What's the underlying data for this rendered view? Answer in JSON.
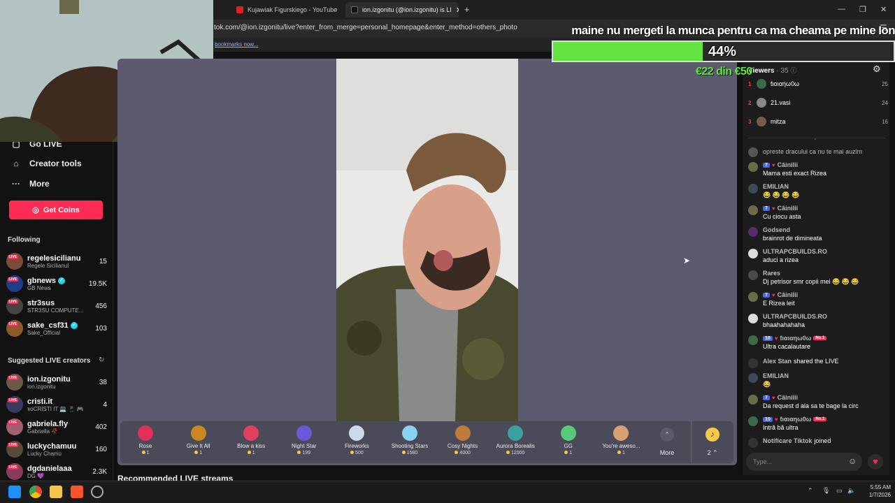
{
  "browser": {
    "tabs": [
      {
        "title": "Kujawiak Figurskiego - YouTube",
        "active": false
      },
      {
        "title": "ion.izgonitu (@ion.izgonitu) is LI",
        "active": true
      }
    ],
    "url": "tok.com/@ion.izgonitu/live?enter_from_merge=personal_homepage&enter_method=others_photo",
    "bookmarks_link": "bookmarks now..."
  },
  "overlay": {
    "goal_text": "maine nu mergeti la munca pentru ca ma cheama pe mine Ion",
    "goal_percent_label": "44%",
    "goal_fraction": 0.44,
    "goal_amount": "€22 din €50"
  },
  "sidebar": {
    "nav": [
      {
        "label": "Go LIVE",
        "icon": "camera-icon"
      },
      {
        "label": "Creator tools",
        "icon": "home-icon"
      },
      {
        "label": "More",
        "icon": "more-icon"
      }
    ],
    "get_coins": "Get Coins",
    "following_title": "Following",
    "following": [
      {
        "name": "regelesicilianu",
        "sub": "Regele Sicilianul",
        "count": "15",
        "color": "#7a4b3a",
        "verified": false
      },
      {
        "name": "gbnews",
        "sub": "GB News",
        "count": "19.5K",
        "color": "#1f3c88",
        "verified": true
      },
      {
        "name": "str3sus",
        "sub": "STR3SU COMPUTE...",
        "count": "456",
        "color": "#444",
        "verified": false
      },
      {
        "name": "sake_csf31",
        "sub": "Sake_Official",
        "count": "103",
        "color": "#8a5a2a",
        "verified": true
      }
    ],
    "suggested_title": "Suggested LIVE creators",
    "suggested": [
      {
        "name": "ion.izgonitu",
        "sub": "ion.izgonitu",
        "count": "38",
        "color": "#6b5a48"
      },
      {
        "name": "cristi.it",
        "sub": "ҡᴏCRISTI IT 💻 📱 🎮",
        "count": "4",
        "color": "#3a3a5a"
      },
      {
        "name": "gabriela.fly",
        "sub": "Gabriella 🥀",
        "count": "402",
        "color": "#a06070"
      },
      {
        "name": "luckychamuu",
        "sub": "Lucky Chamu",
        "count": "160",
        "color": "#5a4a3a"
      },
      {
        "name": "dgdanielaaa",
        "sub": "DG 💜",
        "count": "2.3K",
        "color": "#8a3a5a"
      }
    ]
  },
  "gifts": [
    {
      "name": "Rose",
      "price": "1",
      "color": "#e0315a"
    },
    {
      "name": "Give It All",
      "price": "1",
      "color": "#c98a1f"
    },
    {
      "name": "Blow a kiss",
      "price": "1",
      "color": "#e04060"
    },
    {
      "name": "Night Star",
      "price": "199",
      "color": "#6a5ad8"
    },
    {
      "name": "Fireworks",
      "price": "500",
      "color": "#cfd8e8"
    },
    {
      "name": "Shooting Stars",
      "price": "1580",
      "color": "#8ad0f0"
    },
    {
      "name": "Cosy Nights",
      "price": "4000",
      "color": "#c07a3a"
    },
    {
      "name": "Aurora Borealis",
      "price": "12000",
      "color": "#3aa0a0"
    },
    {
      "name": "GG",
      "price": "1",
      "color": "#5ac87a"
    },
    {
      "name": "You're aweso...",
      "price": "1",
      "color": "#d8a070"
    }
  ],
  "gift_more": "More",
  "coin_count": "2",
  "recommended": "Recommended LIVE streams",
  "chat": {
    "viewers_label": "Viewers",
    "viewers_count": "· 35",
    "top": [
      {
        "rank": "1",
        "name": "ƭιαιαηω0ω",
        "score": "25",
        "color": "#3a6a4a"
      },
      {
        "rank": "2",
        "name": "21.vasi",
        "score": "24",
        "color": "#888"
      },
      {
        "rank": "3",
        "name": "mitza",
        "score": "16",
        "color": "#7a5a4a"
      }
    ],
    "messages": [
      {
        "user": "",
        "text": "opreste dracului ca nu te mai auzim",
        "level": "",
        "color": "#555"
      },
      {
        "user": "Câinilii",
        "text": "Mama esti exact Rizea",
        "level": "7",
        "color": "#6b6b4a"
      },
      {
        "user": "EMILIAN",
        "text": "😂 😂 😂 😂",
        "level": "",
        "color": "#3a4a5a"
      },
      {
        "user": "Câinilii",
        "text": "Cu ciocu asta",
        "level": "7",
        "color": "#6b6b4a"
      },
      {
        "user": "Godsend",
        "text": "brainrot de dimineata",
        "level": "",
        "color": "#5a2a6a"
      },
      {
        "user": "ULTRAPCBUILDS.RO",
        "text": "aduci a rizea",
        "level": "",
        "color": "#ddd"
      },
      {
        "user": "Rares",
        "text": "Dj petrisor smr copii mei 😂 😂 😂",
        "level": "",
        "color": "#4a4a4a"
      },
      {
        "user": "Câinilii",
        "text": "E Rizea leit",
        "level": "7",
        "color": "#6b6b4a"
      },
      {
        "user": "ULTRAPCBUILDS.RO",
        "text": "bhaahahahaha",
        "level": "",
        "color": "#ddd"
      },
      {
        "user": "ƭιαιαηω0ω",
        "text": "Ultra cacalautare",
        "level": "10",
        "color": "#3a6a4a",
        "no1": "No.1"
      },
      {
        "user": "Alex Stan",
        "text": "shared the LIVE",
        "level": "",
        "color": "#333",
        "inline": true
      },
      {
        "user": "EMILIAN",
        "text": "😂",
        "level": "",
        "color": "#3a4a5a"
      },
      {
        "user": "Câinilii",
        "text": "Da request d ala sa te bage la circ",
        "level": "7",
        "color": "#6b6b4a"
      },
      {
        "user": "ƭιαιαηω0ω",
        "text": "Intră bă ultra",
        "level": "10",
        "color": "#3a6a4a",
        "no1": "No.1"
      },
      {
        "user": "Notificare Tiktok",
        "text": "joined",
        "level": "",
        "color": "#333",
        "inline": true
      }
    ],
    "input_placeholder": "Type..."
  },
  "taskbar": {
    "time": "5:55 AM",
    "date": "1/7/2026"
  }
}
